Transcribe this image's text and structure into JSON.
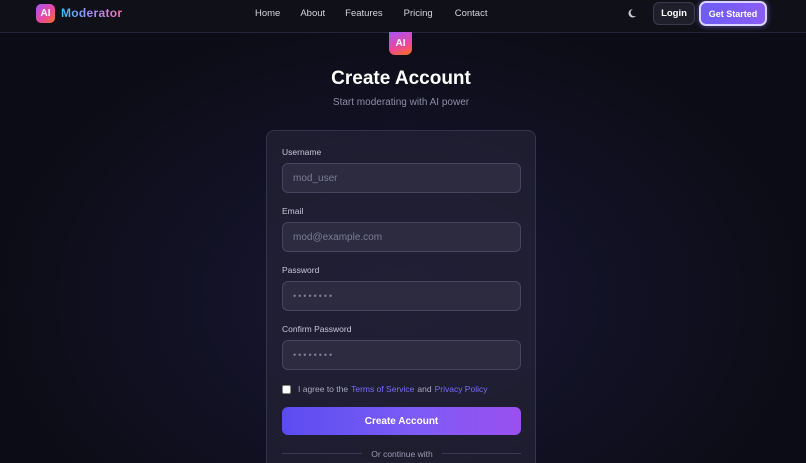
{
  "nav": {
    "brand_badge": "AI",
    "brand_name": "Moderator",
    "links": [
      "Home",
      "About",
      "Features",
      "Pricing",
      "Contact"
    ],
    "theme_icon": "moon-icon",
    "login_label": "Login",
    "get_started_label": "Get Started"
  },
  "hero": {
    "badge": "AI",
    "title": "Create Account",
    "subtitle": "Start moderating with AI power"
  },
  "form": {
    "username_label": "Username",
    "username_placeholder": "mod_user",
    "email_label": "Email",
    "email_placeholder": "mod@example.com",
    "password_label": "Password",
    "password_placeholder": "••••••••",
    "confirm_label": "Confirm Password",
    "confirm_placeholder": "••••••••",
    "agree_prefix": "I agree to the",
    "terms_link": "Terms of Service",
    "agree_and": "and",
    "privacy_link": "Privacy Policy",
    "submit_label": "Create Account",
    "divider_text": "Or continue with"
  },
  "colors": {
    "accent": "#7c5cf6",
    "background": "#0c0c16",
    "card": "#222134",
    "link": "#7c6cf8"
  }
}
